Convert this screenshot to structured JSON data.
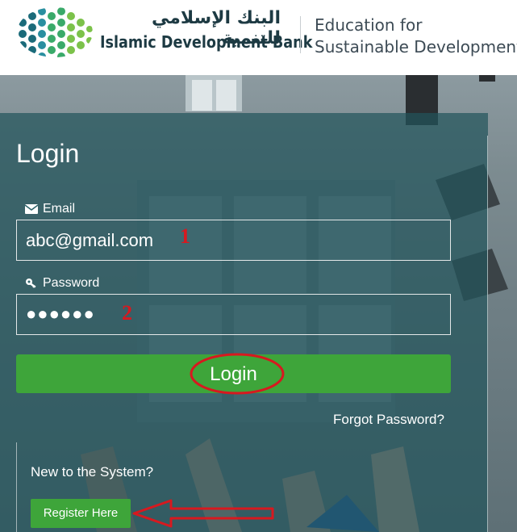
{
  "header": {
    "bank_name_arabic": "البنك الإسلامي للتنمية",
    "bank_name_english": "Islamic Development Bank",
    "tagline_line1": "Education for",
    "tagline_line2": "Sustainable Development"
  },
  "form": {
    "title": "Login",
    "email_label": "Email",
    "email_value": "abc@gmail.com",
    "password_label": "Password",
    "password_value": "●●●●●●",
    "login_button": "Login",
    "forgot_link": "Forgot Password?",
    "new_user_text": "New to the System?",
    "register_button": "Register Here"
  },
  "annotations": {
    "step1": "1",
    "step2": "2"
  },
  "colors": {
    "brand_dark": "#1d3a43",
    "button_green": "#3ea53a",
    "panel_overlay": "#22545c",
    "annotation_red": "#d7191f"
  },
  "icons": {
    "email": "envelope-icon",
    "password": "key-icon"
  }
}
